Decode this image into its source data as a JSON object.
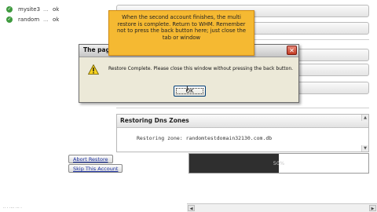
{
  "accounts": [
    {
      "name": "mysite3",
      "dots": "...",
      "status": "ok"
    },
    {
      "name": "random",
      "dots": "...",
      "status": "ok"
    }
  ],
  "callout": {
    "text": "When the second account finishes, the multi restore is complete. Return to WHM. Remember not to press the back button here; just close the tab or window"
  },
  "dialog": {
    "title": "The page",
    "message": "Restore Complete.  Please close this window without pressing the back button.",
    "ok_label": "OK",
    "close_glyph": "✕"
  },
  "dns": {
    "header": "Restoring Dns Zones",
    "line": "Restoring zone: randomtestdomain32130.com.db"
  },
  "buttons": {
    "abort": "Abort Restore",
    "skip": "Skip This Account"
  },
  "progress": {
    "label": "50%",
    "fraction": 0.5
  },
  "partial_label": "2",
  "bottom_dots": "·· · ···· ··· ·",
  "icons": {
    "check": "check-circle-icon",
    "warning": "warning-triangle-icon",
    "close": "close-icon"
  },
  "colors": {
    "callout": "#f5b932",
    "status_ok": "#3f9a3f",
    "close_button": "#c23b22"
  }
}
